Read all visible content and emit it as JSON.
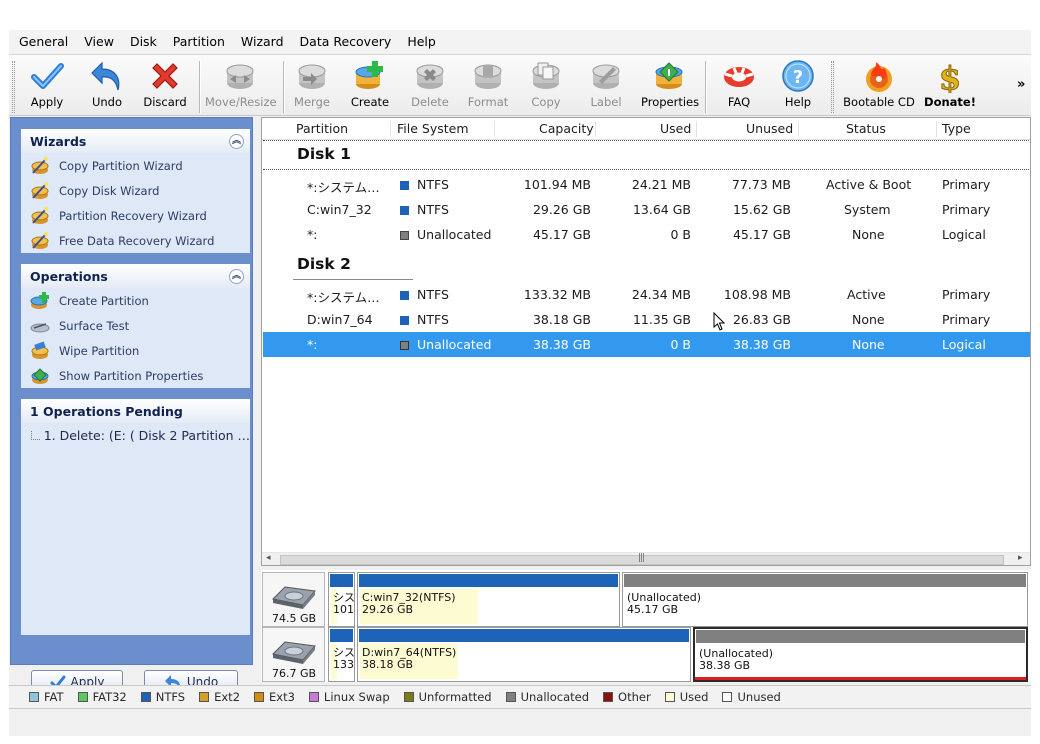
{
  "menu": [
    "General",
    "View",
    "Disk",
    "Partition",
    "Wizard",
    "Data Recovery",
    "Help"
  ],
  "toolbar": {
    "apply": "Apply",
    "undo": "Undo",
    "discard": "Discard",
    "move_resize": "Move/Resize",
    "merge": "Merge",
    "create": "Create",
    "delete": "Delete",
    "format": "Format",
    "copy": "Copy",
    "label": "Label",
    "properties": "Properties",
    "faq": "FAQ",
    "help": "Help",
    "bootable_cd": "Bootable CD",
    "donate": "Donate!",
    "more": "»"
  },
  "wizards": {
    "title": "Wizards",
    "items": [
      "Copy Partition Wizard",
      "Copy Disk Wizard",
      "Partition Recovery Wizard",
      "Free Data Recovery Wizard"
    ]
  },
  "operations": {
    "title": "Operations",
    "items": [
      "Create Partition",
      "Surface Test",
      "Wipe Partition",
      "Show Partition Properties"
    ]
  },
  "pending": {
    "title": "1 Operations Pending",
    "items": [
      "1. Delete: (E: ( Disk 2 Partition …"
    ]
  },
  "left_buttons": {
    "apply": "Apply",
    "undo": "Undo"
  },
  "table": {
    "columns": [
      "Partition",
      "File System",
      "Capacity",
      "Used",
      "Unused",
      "Status",
      "Type"
    ],
    "disks": [
      {
        "name": "Disk 1",
        "rows": [
          {
            "partition": "*:システム…",
            "fs": "NTFS",
            "fs_color": "#1d64b8",
            "capacity": "101.94 MB",
            "used": "24.21 MB",
            "unused": "77.73 MB",
            "status": "Active & Boot",
            "type": "Primary"
          },
          {
            "partition": "C:win7_32",
            "fs": "NTFS",
            "fs_color": "#1d64b8",
            "capacity": "29.26 GB",
            "used": "13.64 GB",
            "unused": "15.62 GB",
            "status": "System",
            "type": "Primary"
          },
          {
            "partition": "*:",
            "fs": "Unallocated",
            "fs_color": "#808080",
            "capacity": "45.17 GB",
            "used": "0 B",
            "unused": "45.17 GB",
            "status": "None",
            "type": "Logical"
          }
        ]
      },
      {
        "name": "Disk 2",
        "rows": [
          {
            "partition": "*:システム…",
            "fs": "NTFS",
            "fs_color": "#1d64b8",
            "capacity": "133.32 MB",
            "used": "24.34 MB",
            "unused": "108.98 MB",
            "status": "Active",
            "type": "Primary"
          },
          {
            "partition": "D:win7_64",
            "fs": "NTFS",
            "fs_color": "#1d64b8",
            "capacity": "38.18 GB",
            "used": "11.35 GB",
            "unused": "26.83 GB",
            "status": "None",
            "type": "Primary"
          },
          {
            "partition": "*:",
            "fs": "Unallocated",
            "fs_color": "#808080",
            "capacity": "38.38 GB",
            "used": "0 B",
            "unused": "38.38 GB",
            "status": "None",
            "type": "Logical",
            "selected": true
          }
        ]
      }
    ]
  },
  "diskmap": {
    "disk1": {
      "size": "74.5 GB",
      "p1": {
        "line1": "シス",
        "line2": "101"
      },
      "p2": {
        "line1": "C:win7_32(NTFS)",
        "line2": "29.26 GB"
      },
      "p3": {
        "line1": "(Unallocated)",
        "line2": "45.17 GB"
      }
    },
    "disk2": {
      "size": "76.7 GB",
      "p1": {
        "line1": "シス",
        "line2": "133"
      },
      "p2": {
        "line1": "D:win7_64(NTFS)",
        "line2": "38.18 GB"
      },
      "p3": {
        "line1": "(Unallocated)",
        "line2": "38.38 GB"
      }
    }
  },
  "legend": [
    {
      "label": "FAT",
      "color": "#8fc7d9"
    },
    {
      "label": "FAT32",
      "color": "#5dc85d"
    },
    {
      "label": "NTFS",
      "color": "#1d64b8"
    },
    {
      "label": "Ext2",
      "color": "#d4a02a"
    },
    {
      "label": "Ext3",
      "color": "#d68a14"
    },
    {
      "label": "Linux Swap",
      "color": "#c97ad8"
    },
    {
      "label": "Unformatted",
      "color": "#7a7a1a"
    },
    {
      "label": "Unallocated",
      "color": "#808080"
    },
    {
      "label": "Other",
      "color": "#8b1010"
    },
    {
      "label": "Used",
      "color": "#fdfbd2"
    },
    {
      "label": "Unused",
      "color": "#ffffff"
    }
  ]
}
